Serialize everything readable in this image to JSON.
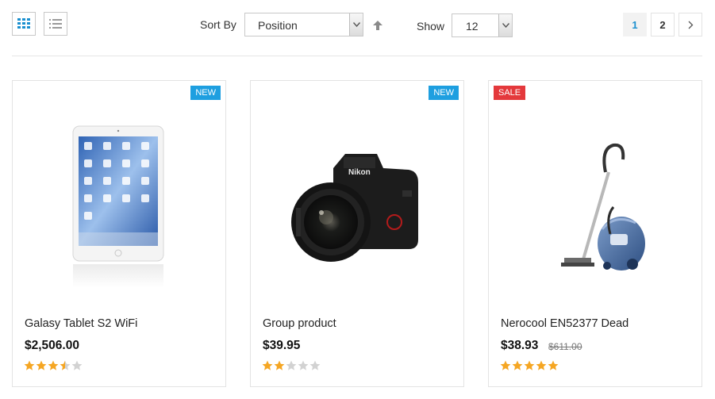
{
  "toolbar": {
    "view_grid_icon": "grid-view-icon",
    "view_list_icon": "list-view-icon",
    "sort_label": "Sort By",
    "sort_value": "Position",
    "sort_direction_icon": "arrow-up-icon",
    "show_label": "Show",
    "show_value": "12",
    "pages": [
      "1",
      "2"
    ],
    "current_page": "1",
    "next_icon": "chevron-right-icon"
  },
  "colors": {
    "accent": "#1a8fcf",
    "new_badge": "#1e9fe0",
    "sale_badge": "#e4393c",
    "star_on": "#f5a623",
    "star_off": "#d2d2d2"
  },
  "products": [
    {
      "badge": "NEW",
      "image_icon": "tablet-image",
      "name": "Galasy Tablet S2 WiFi",
      "price": "$2,506.00",
      "old_price": "",
      "rating": 3.5
    },
    {
      "badge": "NEW",
      "image_icon": "camera-image",
      "name": "Group product",
      "price": "$39.95",
      "old_price": "",
      "rating": 2
    },
    {
      "badge": "SALE",
      "image_icon": "vacuum-cleaner-image",
      "name": "Nerocool EN52377 Dead",
      "price": "$38.93",
      "old_price": "$611.00",
      "rating": 5
    }
  ]
}
